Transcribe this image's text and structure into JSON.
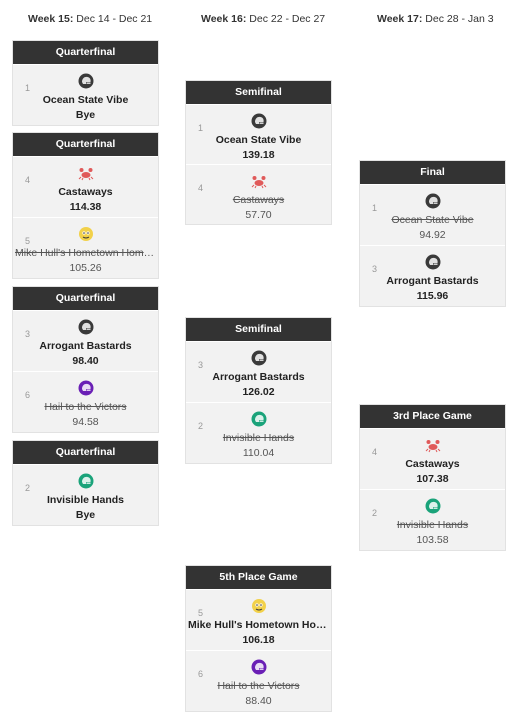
{
  "weeks": [
    {
      "label": "Week 15:",
      "dates": "Dec 14 - Dec 21"
    },
    {
      "label": "Week 16:",
      "dates": "Dec 22 - Dec 27"
    },
    {
      "label": "Week 17:",
      "dates": "Dec 28 - Jan 3"
    }
  ],
  "matchups": {
    "qf1": {
      "title": "Quarterfinal",
      "team1": {
        "seed": "1",
        "name": "Ocean State Vibe",
        "score": "Bye",
        "icon": "helmet-dark-icon"
      }
    },
    "qf2": {
      "title": "Quarterfinal",
      "team1": {
        "seed": "4",
        "name": "Castaways",
        "score": "114.38",
        "icon": "crab-icon"
      },
      "team2": {
        "seed": "5",
        "name": "Mike Hull's Hometown Homies",
        "score": "105.26",
        "icon": "mascot-icon"
      }
    },
    "qf3": {
      "title": "Quarterfinal",
      "team1": {
        "seed": "3",
        "name": "Arrogant Bastards",
        "score": "98.40",
        "icon": "helmet-dark-icon"
      },
      "team2": {
        "seed": "6",
        "name": "Hail to the Victors",
        "score": "94.58",
        "icon": "helmet-purple-icon"
      }
    },
    "qf4": {
      "title": "Quarterfinal",
      "team1": {
        "seed": "2",
        "name": "Invisible Hands",
        "score": "Bye",
        "icon": "helmet-teal-icon"
      }
    },
    "sf1": {
      "title": "Semifinal",
      "team1": {
        "seed": "1",
        "name": "Ocean State Vibe",
        "score": "139.18",
        "icon": "helmet-dark-icon"
      },
      "team2": {
        "seed": "4",
        "name": "Castaways",
        "score": "57.70",
        "icon": "crab-icon"
      }
    },
    "sf2": {
      "title": "Semifinal",
      "team1": {
        "seed": "3",
        "name": "Arrogant Bastards",
        "score": "126.02",
        "icon": "helmet-dark-icon"
      },
      "team2": {
        "seed": "2",
        "name": "Invisible Hands",
        "score": "110.04",
        "icon": "helmet-teal-icon"
      }
    },
    "fifth": {
      "title": "5th Place Game",
      "team1": {
        "seed": "5",
        "name": "Mike Hull's Hometown Hom...",
        "score": "106.18",
        "icon": "mascot-icon"
      },
      "team2": {
        "seed": "6",
        "name": "Hail to the Victors",
        "score": "88.40",
        "icon": "helmet-purple-icon"
      }
    },
    "final": {
      "title": "Final",
      "team1": {
        "seed": "1",
        "name": "Ocean State Vibe",
        "score": "94.92",
        "icon": "helmet-dark-icon"
      },
      "team2": {
        "seed": "3",
        "name": "Arrogant Bastards",
        "score": "115.96",
        "icon": "helmet-dark-icon"
      }
    },
    "third": {
      "title": "3rd Place Game",
      "team1": {
        "seed": "4",
        "name": "Castaways",
        "score": "107.38",
        "icon": "crab-icon"
      },
      "team2": {
        "seed": "2",
        "name": "Invisible Hands",
        "score": "103.58",
        "icon": "helmet-teal-icon"
      }
    }
  },
  "colors": {
    "card_header_bg": "#333333",
    "card_bg": "#f2f2f2",
    "helmet_dark": "#3a3a3a",
    "helmet_purple": "#6a1fb5",
    "helmet_teal": "#1aa37a",
    "crab": "#e05a5a"
  }
}
